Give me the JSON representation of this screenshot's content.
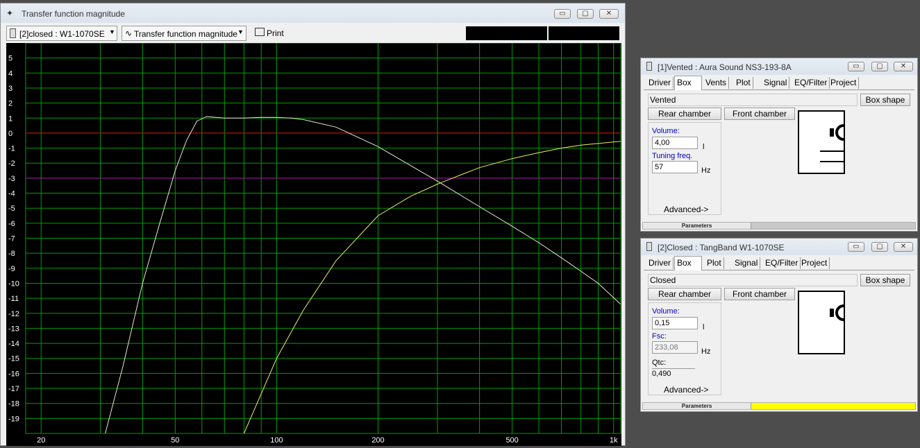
{
  "main_window": {
    "title": "Transfer function magnitude",
    "project_select": "[2]closed : W1-1070SE",
    "plot_select": "Transfer function magnitude",
    "print_label": "Print"
  },
  "chart_data": {
    "type": "line",
    "x_scale": "log",
    "xlim": [
      18,
      1050
    ],
    "ylim": [
      -20,
      6
    ],
    "x_ticks": [
      {
        "value": 20,
        "label": "20"
      },
      {
        "value": 50,
        "label": "50"
      },
      {
        "value": 100,
        "label": "100"
      },
      {
        "value": 200,
        "label": "200"
      },
      {
        "value": 500,
        "label": "500"
      },
      {
        "value": 1000,
        "label": "1k"
      }
    ],
    "y_ticks": [
      5,
      4,
      3,
      2,
      1,
      0,
      -1,
      -2,
      -3,
      -4,
      -5,
      -6,
      -7,
      -8,
      -9,
      -10,
      -11,
      -12,
      -13,
      -14,
      -15,
      -16,
      -17,
      -18,
      -19
    ],
    "grid": true,
    "reference_lines": [
      {
        "y": 0,
        "color": "#e00000"
      },
      {
        "y": -3,
        "color": "#b000b0"
      }
    ],
    "series": [
      {
        "color": "#e8e8d0",
        "x": [
          31,
          35,
          40,
          45,
          50,
          54,
          58,
          62,
          70,
          80,
          90,
          100,
          110,
          120,
          150,
          200,
          300,
          400,
          500,
          600,
          700,
          800,
          900,
          1050
        ],
        "y": [
          -20,
          -15.5,
          -10,
          -6,
          -2.5,
          -0.5,
          0.8,
          1.1,
          1.0,
          1.0,
          1.05,
          1.05,
          1.0,
          0.9,
          0.4,
          -0.9,
          -3.2,
          -4.9,
          -6.2,
          -7.3,
          -8.3,
          -9.2,
          -10.0,
          -11.4
        ]
      },
      {
        "color": "#f0f060",
        "x": [
          80,
          100,
          120,
          150,
          200,
          250,
          300,
          350,
          400,
          500,
          600,
          700,
          800,
          1050
        ],
        "y": [
          -20,
          -15,
          -11.8,
          -8.5,
          -5.5,
          -4.2,
          -3.4,
          -2.8,
          -2.3,
          -1.7,
          -1.3,
          -1.0,
          -0.8,
          -0.55
        ]
      }
    ]
  },
  "vented_window": {
    "title": "[1]Vented : Aura Sound NS3-193-8A",
    "tabs": [
      "Driver",
      "Box",
      "Vents",
      "Plot",
      "Signal",
      "EQ/Filter",
      "Project"
    ],
    "box_type": "Vented",
    "box_shape_btn": "Box shape",
    "rear_btn": "Rear chamber",
    "front_btn": "Front chamber",
    "volume_label": "Volume:",
    "volume_value": "4,00",
    "volume_unit": "l",
    "tuning_label": "Tuning freq.",
    "tuning_value": "57",
    "tuning_unit": "Hz",
    "advanced": "Advanced->",
    "status": "Parameters",
    "status_color": "#c8c8c8"
  },
  "closed_window": {
    "title": "[2]Closed : TangBand W1-1070SE",
    "tabs": [
      "Driver",
      "Box",
      "Plot",
      "Signal",
      "EQ/Filter",
      "Project"
    ],
    "box_type": "Closed",
    "box_shape_btn": "Box shape",
    "rear_btn": "Rear chamber",
    "front_btn": "Front chamber",
    "volume_label": "Volume:",
    "volume_value": "0,15",
    "volume_unit": "l",
    "fsc_label": "Fsc:",
    "fsc_value": "233,08",
    "fsc_unit": "Hz",
    "qtc_label": "Qtc:",
    "qtc_value": "0,490",
    "advanced": "Advanced->",
    "status": "Parameters",
    "status_color": "#ffff00"
  },
  "window_controls": {
    "minimize": "▭",
    "restore": "▢",
    "close": "✕"
  }
}
